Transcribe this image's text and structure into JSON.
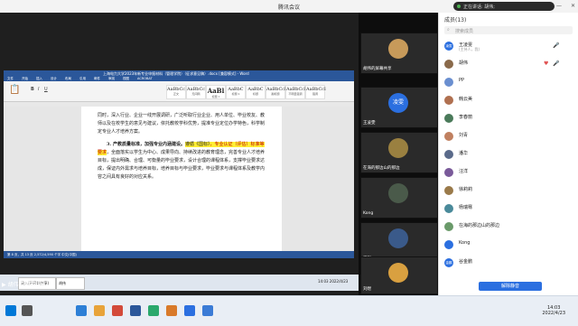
{
  "window": {
    "title": "腾讯会议",
    "controls": [
      "—",
      "□",
      "✕"
    ]
  },
  "speaking": {
    "label": "正在讲话: 胡伟;"
  },
  "share": {
    "label": "胡伟的屏幕共享",
    "word_title": "上海电力大学2023年新专业申报材料（管理学院）（征求意见稿）.docx [兼容模式] - Word",
    "ribbon_tabs": [
      "文件",
      "开始",
      "插入",
      "设计",
      "布局",
      "引用",
      "邮件",
      "审阅",
      "视图",
      "ACROBAT"
    ],
    "styles": [
      {
        "sample": "AaBbCc",
        "name": "正文"
      },
      {
        "sample": "AaBbCc",
        "name": "无间隔"
      },
      {
        "sample": "AaBl",
        "name": "标题 1"
      },
      {
        "sample": "AaBbC",
        "name": "标题 2"
      },
      {
        "sample": "AaBbC",
        "name": "标题"
      },
      {
        "sample": "AaBbCcl",
        "name": "副标题"
      },
      {
        "sample": "AaBbCcl",
        "name": "不明显强调"
      },
      {
        "sample": "AaBbCcl",
        "name": "强调"
      }
    ],
    "doc": {
      "p1": "同时，深入行业、企业一线开展调研，广泛听取行业企业、用人单位、毕业校友、教师以及在校学生的意见与建议，依托教校学科优势，提准专业定位办学特色，科学制定专业人才培养方案。",
      "p2_heading": "3. 产教质量标准，加强专业内涵建设。",
      "p2_hl1": "遵循《国标》",
      "p2_red1": "，专业认证（评估）标准等要求",
      "p2_rest": "，全面落实以学生为中心、成果导向、持续改进的教育理念，完善专业人才培养目标，提出明确、合理、可衡量的毕业要求，设计合理的课程体系，支撑毕业要求达成，保证内外需求与培养目标，培养目标与毕业要求，毕业要求与课程体系及教学内容之间具有良好的对应关系。"
    },
    "statusbar": "第 8 页，共 13 页    2,572/4,590 个字    中文(中国)",
    "inner_tabs": [
      "录入(已开始共享)",
      "胡伟"
    ],
    "inner_clock": "14:03 2022/4/23"
  },
  "videos": [
    {
      "name": "胡伟的屏幕共享",
      "muted": false
    },
    {
      "name": "王凌雯",
      "avatar_text": "凌雯",
      "muted": true
    },
    {
      "name": "在海的那边山的那边",
      "muted": true
    },
    {
      "name": "Kong",
      "muted": true
    },
    {
      "name": "汪洋",
      "muted": true
    },
    {
      "name": "刘煜",
      "muted": true
    }
  ],
  "panel": {
    "title": "成员(13)",
    "search_placeholder": "搜索成员",
    "members": [
      {
        "name": "王凌雯",
        "sub": "(主持人，我)",
        "avatar": "凌雯",
        "color": "#2b6fe0"
      },
      {
        "name": "胡伟",
        "sub": "",
        "avatar": "",
        "color": "#8a6a4a"
      },
      {
        "name": "PP",
        "sub": "",
        "avatar": "",
        "color": "#6a8fd0"
      },
      {
        "name": "韩云美",
        "sub": "",
        "avatar": "",
        "color": "#b07050"
      },
      {
        "name": "李春丽",
        "sub": "",
        "avatar": "",
        "color": "#4a7a5a"
      },
      {
        "name": "刘青",
        "sub": "",
        "avatar": "",
        "color": "#c08060"
      },
      {
        "name": "潘华",
        "sub": "",
        "avatar": "",
        "color": "#5a6a8a"
      },
      {
        "name": "汪洋",
        "sub": "",
        "avatar": "",
        "color": "#7a5a9a"
      },
      {
        "name": "徐莉莉",
        "sub": "",
        "avatar": "",
        "color": "#9a7a4a"
      },
      {
        "name": "杨瑞骞",
        "sub": "",
        "avatar": "",
        "color": "#4a8a9a"
      },
      {
        "name": "在海的那边山的那边",
        "sub": "",
        "avatar": "",
        "color": "#6a9a6a"
      },
      {
        "name": "Kong",
        "sub": "",
        "avatar": "",
        "color": "#2b6fe0"
      },
      {
        "name": "谷金鹏",
        "sub": "",
        "avatar": "金鹏",
        "color": "#2b6fe0"
      }
    ],
    "unmute_all": "解除静音"
  },
  "taskbar": {
    "time": "14:03",
    "date": "2022/4/23"
  }
}
